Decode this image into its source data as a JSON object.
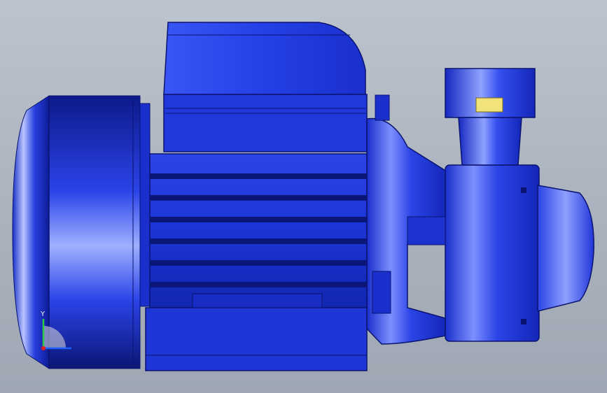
{
  "viewport": {
    "background_top": "#bcc3cc",
    "background_bottom": "#9ea7b3"
  },
  "model": {
    "part": "centrifugal-pump-assembly",
    "view": "side",
    "body_color": "#1a2fd0",
    "highlight_color": "#8ea0ff",
    "shadow_color": "#0a1370",
    "accent_color": "#f2e27a"
  },
  "triad": {
    "y_label": "Y",
    "x_label": "",
    "colors": {
      "x": "#e02020",
      "y": "#2ecc40",
      "z": "#2060ff"
    }
  }
}
